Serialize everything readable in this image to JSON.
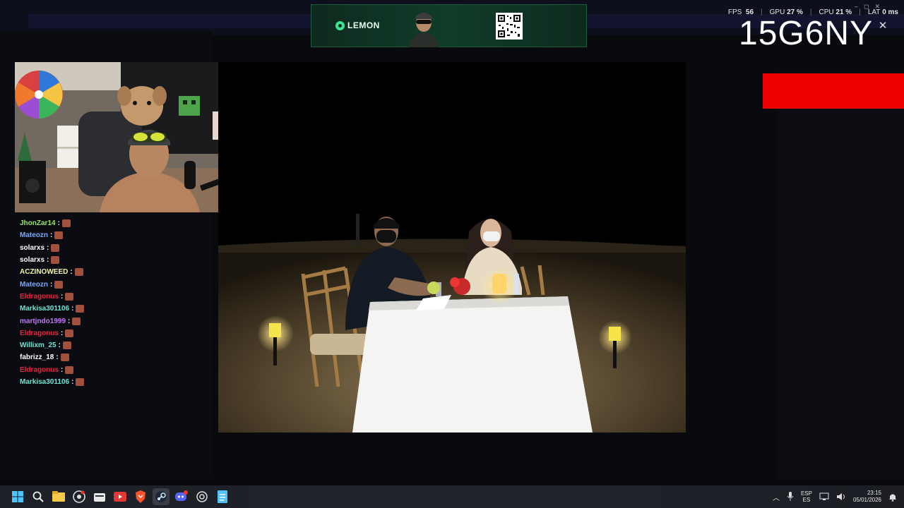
{
  "banner": {
    "brand": "LEMON"
  },
  "perf": {
    "fps_label": "FPS",
    "fps": "56",
    "gpu_label": "GPU",
    "gpu": "27 %",
    "cpu_label": "CPU",
    "cpu": "21 %",
    "lat_label": "LAT",
    "lat": "0 ms"
  },
  "overlay_code": "15G6NY",
  "chat": [
    {
      "user": "JhonZar14",
      "color": "#9be070"
    },
    {
      "user": "Mateozn",
      "color": "#7aa7ff"
    },
    {
      "user": "solarxs",
      "color": "#ffffff"
    },
    {
      "user": "solarxs",
      "color": "#ffffff"
    },
    {
      "user": "ACZINOWEED",
      "color": "#f2f2b0"
    },
    {
      "user": "Mateozn",
      "color": "#7aa7ff"
    },
    {
      "user": "Eldragonus",
      "color": "#e2283f"
    },
    {
      "user": "Markisa301106",
      "color": "#6fe6d2"
    },
    {
      "user": "martjndo1999",
      "color": "#c274ff"
    },
    {
      "user": "Eldragonus",
      "color": "#e2283f"
    },
    {
      "user": "Willixm_25",
      "color": "#6fe6d2"
    },
    {
      "user": "fabrizz_18",
      "color": "#ffffff"
    },
    {
      "user": "Eldragonus",
      "color": "#e2283f"
    },
    {
      "user": "Markisa301106",
      "color": "#6fe6d2"
    }
  ],
  "taskbar": {
    "icons": [
      "windows-start-icon",
      "search-icon",
      "file-explorer-icon",
      "chrome-like-icon",
      "store-icon",
      "app-red-icon",
      "brave-icon",
      "steam-icon",
      "discord-icon",
      "app-circle-icon",
      "notepad-icon"
    ],
    "language": "ESP",
    "region": "ES",
    "time": "23:15",
    "date": "05/01/2026"
  }
}
